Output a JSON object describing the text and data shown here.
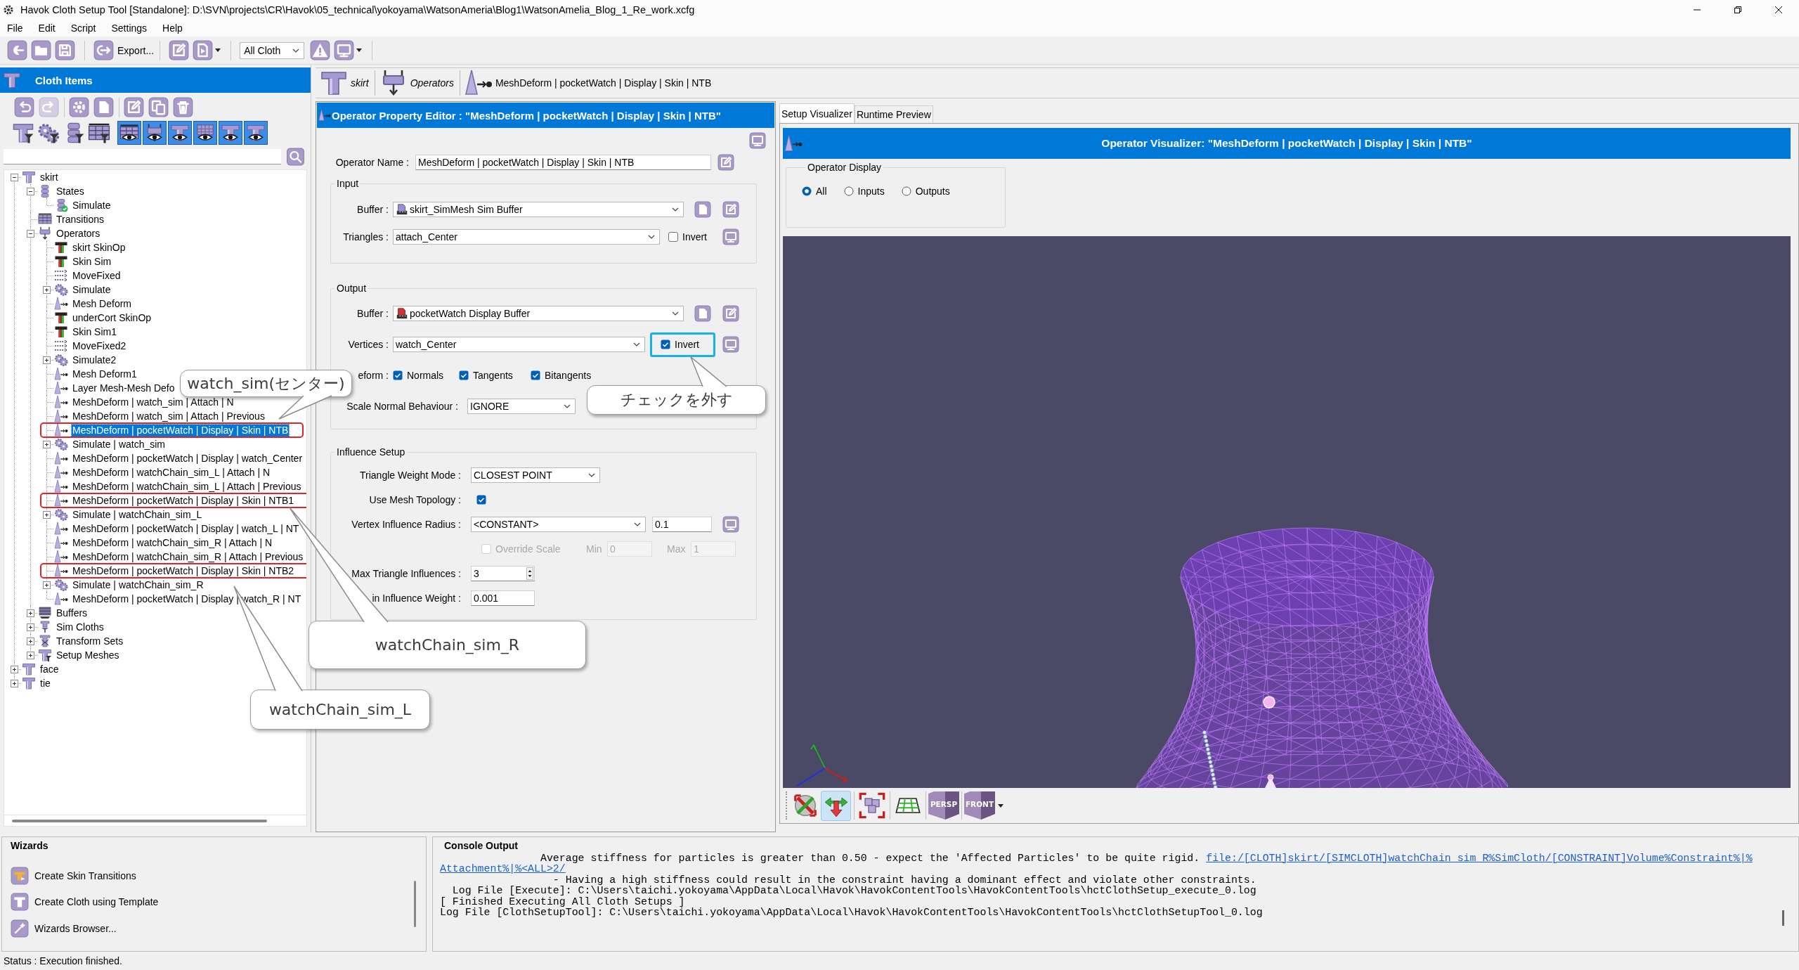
{
  "window": {
    "title": "Havok Cloth Setup Tool [Standalone]: D:\\SVN\\projects\\CR\\Havok\\05_technical\\yokoyama\\WatsonAmeria\\Blog1\\WatsonAmelia_Blog_1_Re_work.xcfg"
  },
  "menu": [
    "File",
    "Edit",
    "Script",
    "Settings",
    "Help"
  ],
  "toolbar": {
    "export": "Export...",
    "cloth_filter": "All Cloth"
  },
  "cloth_items": {
    "title": "Cloth Items",
    "visibility_toggles": [
      {
        "on": true
      },
      {
        "on": true
      },
      {
        "on": true
      },
      {
        "on": true
      },
      {
        "on": true
      },
      {
        "on": true
      }
    ],
    "tree": [
      {
        "label": "skirt",
        "kind": "cloth",
        "expanded": true,
        "selected": false,
        "marked": false,
        "children": [
          {
            "label": "States",
            "kind": "states",
            "expanded": true,
            "selected": false,
            "marked": false,
            "children": [
              {
                "label": "Simulate",
                "kind": "state",
                "selected": false,
                "marked": false
              }
            ]
          },
          {
            "label": "Transitions",
            "kind": "transitions",
            "selected": false,
            "marked": false
          },
          {
            "label": "Operators",
            "kind": "operators",
            "expanded": true,
            "selected": false,
            "marked": false,
            "children": [
              {
                "label": "skirt SkinOp",
                "kind": "skinop",
                "selected": false,
                "marked": false
              },
              {
                "label": "Skin Sim",
                "kind": "skinop",
                "selected": false,
                "marked": false
              },
              {
                "label": "MoveFixed",
                "kind": "movefixed",
                "selected": false,
                "marked": false
              },
              {
                "label": "Simulate",
                "kind": "simulate",
                "expanded": false,
                "selected": false,
                "marked": false
              },
              {
                "label": "Mesh Deform",
                "kind": "meshdeform",
                "selected": false,
                "marked": false
              },
              {
                "label": "underCort SkinOp",
                "kind": "skinop",
                "selected": false,
                "marked": false
              },
              {
                "label": "Skin Sim1",
                "kind": "skinop",
                "selected": false,
                "marked": false
              },
              {
                "label": "MoveFixed2",
                "kind": "movefixed",
                "selected": false,
                "marked": false
              },
              {
                "label": "Simulate2",
                "kind": "simulate",
                "expanded": false,
                "selected": false,
                "marked": false
              },
              {
                "label": "Mesh Deform1",
                "kind": "meshdeform",
                "selected": false,
                "marked": false
              },
              {
                "label": "Layer Mesh-Mesh Defo",
                "kind": "meshdeform",
                "selected": false,
                "marked": false
              },
              {
                "label": "MeshDeform | watch_sim | Attach | N",
                "kind": "meshdeform",
                "selected": false,
                "marked": false
              },
              {
                "label": "MeshDeform | watch_sim | Attach | Previous",
                "kind": "meshdeform",
                "selected": false,
                "marked": false
              },
              {
                "label": "MeshDeform | pocketWatch | Display | Skin | NTB",
                "kind": "meshdeform",
                "selected": true,
                "marked": true
              },
              {
                "label": "Simulate | watch_sim",
                "kind": "simulate",
                "expanded": false,
                "selected": false,
                "marked": false
              },
              {
                "label": "MeshDeform | pocketWatch | Display | watch_Center",
                "kind": "meshdeform",
                "selected": false,
                "marked": false
              },
              {
                "label": "MeshDeform | watchChain_sim_L | Attach | N",
                "kind": "meshdeform",
                "selected": false,
                "marked": false
              },
              {
                "label": "MeshDeform | watchChain_sim_L | Attach | Previous",
                "kind": "meshdeform",
                "selected": false,
                "marked": false
              },
              {
                "label": "MeshDeform | pocketWatch | Display | Skin | NTB1",
                "kind": "meshdeform",
                "selected": false,
                "marked": true
              },
              {
                "label": "Simulate | watchChain_sim_L",
                "kind": "simulate",
                "expanded": false,
                "selected": false,
                "marked": false
              },
              {
                "label": "MeshDeform | pocketWatch | Display | watch_L | NT",
                "kind": "meshdeform",
                "selected": false,
                "marked": false
              },
              {
                "label": "MeshDeform | watchChain_sim_R | Attach | N",
                "kind": "meshdeform",
                "selected": false,
                "marked": false
              },
              {
                "label": "MeshDeform | watchChain_sim_R | Attach | Previous",
                "kind": "meshdeform",
                "selected": false,
                "marked": false
              },
              {
                "label": "MeshDeform | pocketWatch | Display | Skin | NTB2",
                "kind": "meshdeform",
                "selected": false,
                "marked": true
              },
              {
                "label": "Simulate | watchChain_sim_R",
                "kind": "simulate",
                "expanded": false,
                "selected": false,
                "marked": false
              },
              {
                "label": "MeshDeform | pocketWatch | Display | watch_R | NT",
                "kind": "meshdeform",
                "selected": false,
                "marked": false
              }
            ]
          },
          {
            "label": "Buffers",
            "kind": "buffers",
            "expanded": false,
            "selected": false,
            "marked": false
          },
          {
            "label": "Sim Cloths",
            "kind": "simcloths",
            "expanded": false,
            "selected": false,
            "marked": false
          },
          {
            "label": "Transform Sets",
            "kind": "transformsets",
            "expanded": false,
            "selected": false,
            "marked": false
          },
          {
            "label": "Setup Meshes",
            "kind": "setupmeshes",
            "expanded": false,
            "selected": false,
            "marked": false
          }
        ]
      },
      {
        "label": "face",
        "kind": "cloth",
        "expanded": false,
        "selected": false,
        "marked": false
      },
      {
        "label": "tie",
        "kind": "cloth",
        "expanded": false,
        "selected": false,
        "marked": false
      }
    ]
  },
  "breadcrumb": [
    {
      "label": "skirt",
      "kind": "cloth",
      "selected": false
    },
    {
      "label": "Operators",
      "kind": "operators",
      "selected": false
    },
    {
      "label": "MeshDeform | pocketWatch | Display | Skin | NTB",
      "kind": "meshdeform",
      "selected": true
    }
  ],
  "property_editor": {
    "title": "Operator Property Editor : \"MeshDeform | pocketWatch | Display | Skin | NTB\"",
    "operator_name": {
      "label": "Operator Name :",
      "value": "MeshDeform | pocketWatch | Display | Skin | NTB"
    },
    "input": {
      "title": "Input",
      "buffer": {
        "label": "Buffer :",
        "value": "skirt_SimMesh Sim Buffer"
      },
      "triangles": {
        "label": "Triangles :",
        "value": "attach_Center",
        "invert": {
          "label": "Invert",
          "checked": false,
          "highlighted": false
        }
      }
    },
    "output": {
      "title": "Output",
      "buffer": {
        "label": "Buffer :",
        "value": "pocketWatch Display Buffer"
      },
      "vertices": {
        "label": "Vertices :",
        "value": "watch_Center",
        "invert": {
          "label": "Invert",
          "checked": true,
          "highlighted": true
        }
      },
      "deform": {
        "label": "eform :",
        "options": [
          {
            "label": "Normals",
            "checked": true
          },
          {
            "label": "Tangents",
            "checked": true
          },
          {
            "label": "Bitangents",
            "checked": true
          }
        ]
      },
      "scale_normal_behaviour": {
        "label": "Scale Normal Behaviour :",
        "value": "IGNORE"
      }
    },
    "influence": {
      "title": "Influence Setup",
      "triangle_weight_mode": {
        "label": "Triangle Weight Mode :",
        "value": "CLOSEST POINT"
      },
      "use_mesh_topology": {
        "label": "Use Mesh Topology :",
        "checked": true
      },
      "vertex_influence_radius": {
        "label": "Vertex Influence Radius :",
        "mode": "<CONSTANT>",
        "value": "0.1"
      },
      "override_scale": {
        "label": "Override Scale",
        "checked": false,
        "disabled": true,
        "min_label": "Min",
        "min": "0",
        "max_label": "Max",
        "max": "1"
      },
      "max_triangle_influences": {
        "label": "Max Triangle Influences :",
        "value": "3"
      },
      "min_influence_weight": {
        "label": "in Influence Weight :",
        "value": "0.001"
      }
    }
  },
  "visualizer": {
    "tabs": [
      {
        "label": "Setup Visualizer",
        "selected": true
      },
      {
        "label": "Runtime Preview",
        "selected": false
      }
    ],
    "title": "Operator Visualizer: \"MeshDeform | pocketWatch | Display | Skin | NTB\"",
    "display_group": {
      "title": "Operator Display",
      "options": [
        {
          "label": "All",
          "selected": true
        },
        {
          "label": "Inputs",
          "selected": false
        },
        {
          "label": "Outputs",
          "selected": false
        }
      ]
    },
    "view_tools": [
      {
        "selected": false
      },
      {
        "selected": true
      }
    ],
    "projection": "PERSP",
    "view": "FRONT"
  },
  "wizards": {
    "title": "Wizards",
    "items": [
      "Create Skin Transitions",
      "Create Cloth using Template",
      "Wizards Browser..."
    ]
  },
  "console": {
    "title": "Console Output",
    "lines": [
      {
        "text": "                Average stiffness for particles is greater than 0.50 - expect the 'Affected Particles' to be quite rigid.",
        "link": "file:/[CLOTH]skirt/[SIMCLOTH]watchChain_sim_R%SimCloth/[CONSTRAINT]Volume%Constraint%|%"
      },
      {
        "link": "Attachment%|%<ALL>2/"
      },
      {
        "text": "                  - Having a high stiffness could result in the constraint having a dominant effect and violate other constraints."
      },
      {
        "text": "  Log File [Execute]: C:\\Users\\taichi.yokoyama\\AppData\\Local\\Havok\\HavokContentTools\\HavokContentTools\\hctClothSetup_execute_0.log"
      },
      {
        "text": "[ Finished Executing All Cloth Setups ]"
      },
      {
        "text": "Log File [ClothSetupTool]: C:\\Users\\taichi.yokoyama\\AppData\\Local\\Havok\\HavokContentTools\\HavokContentTools\\hctClothSetupTool_0.log"
      }
    ]
  },
  "status_bar": "Status : Execution finished.",
  "callouts": [
    "watch_sim(センター)",
    "チェックを外す",
    "watchChain_sim_R",
    "watchChain_sim_L"
  ]
}
